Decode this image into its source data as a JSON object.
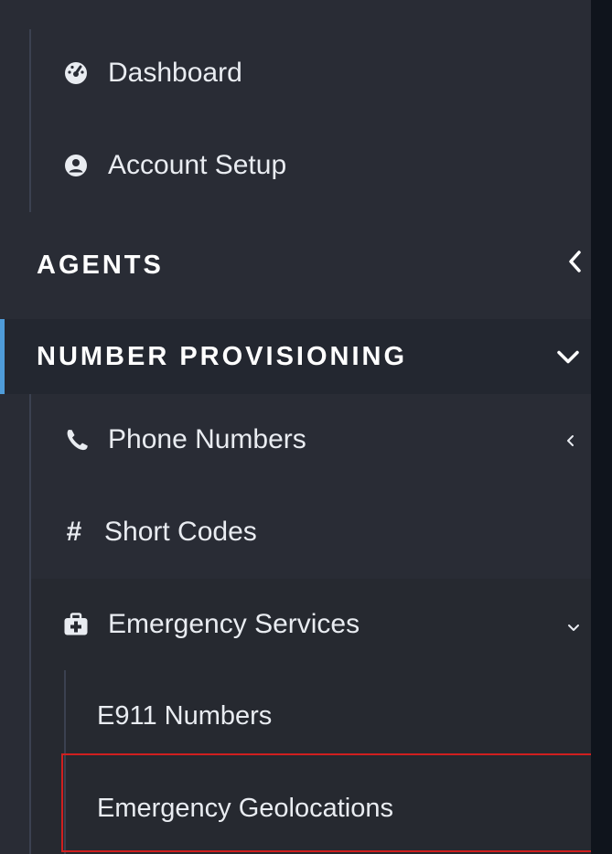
{
  "top_items": [
    {
      "label": "Dashboard",
      "icon": "dashboard-icon"
    },
    {
      "label": "Account Setup",
      "icon": "user-circle-icon"
    }
  ],
  "sections": {
    "agents": {
      "label": "AGENTS",
      "icon": "chevron-left-icon"
    },
    "number_provisioning": {
      "label": "NUMBER PROVISIONING",
      "icon": "chevron-down-icon"
    }
  },
  "number_provisioning_items": [
    {
      "label": "Phone Numbers",
      "icon": "phone-icon",
      "chevron": "chevron-left-icon"
    },
    {
      "label": "Short Codes",
      "icon": "hash-icon"
    },
    {
      "label": "Emergency Services",
      "icon": "medkit-icon",
      "chevron": "chevron-down-icon"
    }
  ],
  "emergency_services_items": [
    {
      "label": "E911 Numbers"
    },
    {
      "label": "Emergency Geolocations"
    }
  ],
  "colors": {
    "sidebar_bg": "#292c35",
    "submenu_bg": "#262930",
    "active_section_bg": "#232730",
    "accent": "#4f9cd9",
    "selection_outline": "#d01f1f",
    "text": "#e9ecf1"
  }
}
